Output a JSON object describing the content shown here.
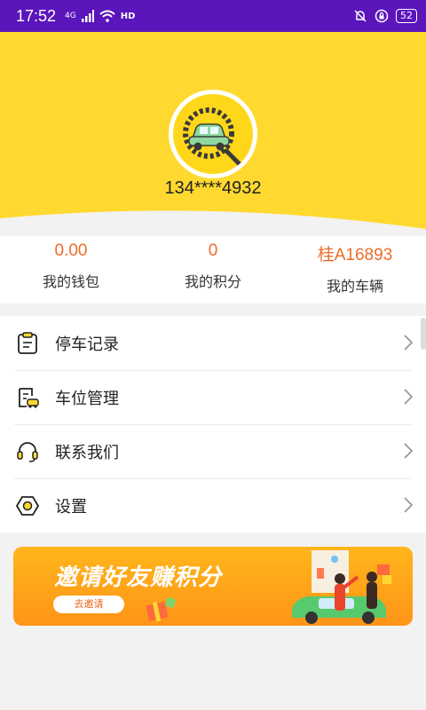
{
  "status_bar": {
    "time": "17:52",
    "network": "4G",
    "hd": "HD",
    "battery": "52"
  },
  "profile": {
    "phone": "134****4932"
  },
  "stats": [
    {
      "value": "0.00",
      "label": "我的钱包"
    },
    {
      "value": "0",
      "label": "我的积分"
    },
    {
      "value": "桂A16893",
      "label": "我的车辆"
    }
  ],
  "menu": [
    {
      "label": "停车记录",
      "icon": "clipboard-icon"
    },
    {
      "label": "车位管理",
      "icon": "parking-doc-icon"
    },
    {
      "label": "联系我们",
      "icon": "headset-icon"
    },
    {
      "label": "设置",
      "icon": "hex-nut-icon"
    }
  ],
  "banner": {
    "title": "邀请好友赚积分",
    "button": "去邀请"
  },
  "colors": {
    "status_bar": "#5a15bb",
    "header": "#ffd930",
    "accent": "#ec6c2b",
    "banner": "#ffa41a"
  }
}
